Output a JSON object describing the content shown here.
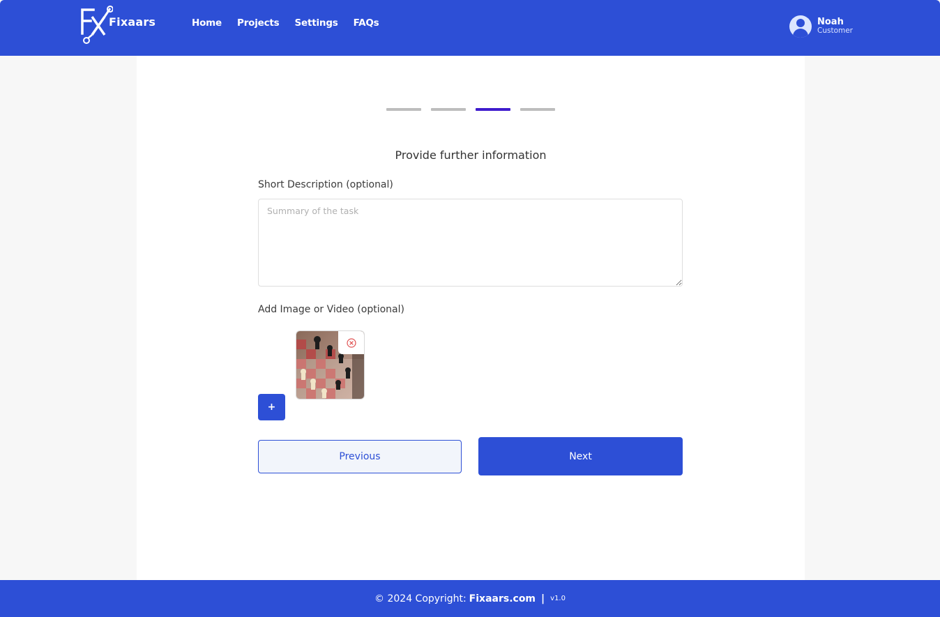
{
  "header": {
    "brand": "Fixaars",
    "nav": [
      "Home",
      "Projects",
      "Settings",
      "FAQs"
    ],
    "user": {
      "name": "Noah",
      "role": "Customer"
    },
    "color": "#2d4fd6"
  },
  "steps": {
    "total": 4,
    "current": 3
  },
  "form": {
    "title": "Provide further information",
    "description_label": "Short Description (optional)",
    "description_placeholder": "Summary of the task",
    "description_value": "",
    "media_label": "Add Image or Video (optional)",
    "media_items": [
      {
        "type": "image",
        "subject": "chess board"
      }
    ],
    "add_label": "+",
    "remove_icon": "close-circle-icon"
  },
  "buttons": {
    "previous": "Previous",
    "next": "Next"
  },
  "footer": {
    "prefix": "© 2024 Copyright:",
    "site": "Fixaars.com",
    "separator": "|",
    "version": "v1.0"
  }
}
